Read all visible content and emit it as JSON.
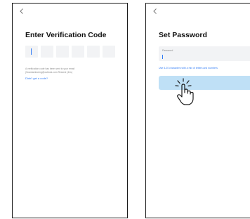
{
  "verification_screen": {
    "back_icon": "chevron-left-icon",
    "title": "Enter Verification Code",
    "code_box_count": 6,
    "info_text": "A verification code has been sent to your email (Scantamboring@outlook.com Resend (41s)",
    "resend_link": "Didn't get a code?"
  },
  "password_screen": {
    "back_icon": "chevron-left-icon",
    "title": "Set Password",
    "password_label": "Password",
    "password_value": "",
    "hint": "Use 6-20 characters with a mix of letters and numbers",
    "done_button": "",
    "gesture_icon": "tap-hand-icon"
  },
  "colors": {
    "accent": "#2f7bf6",
    "field_background": "#f2f3f5",
    "button_disabled": "#bfe0f6",
    "frame_border": "#1a1a1a"
  }
}
